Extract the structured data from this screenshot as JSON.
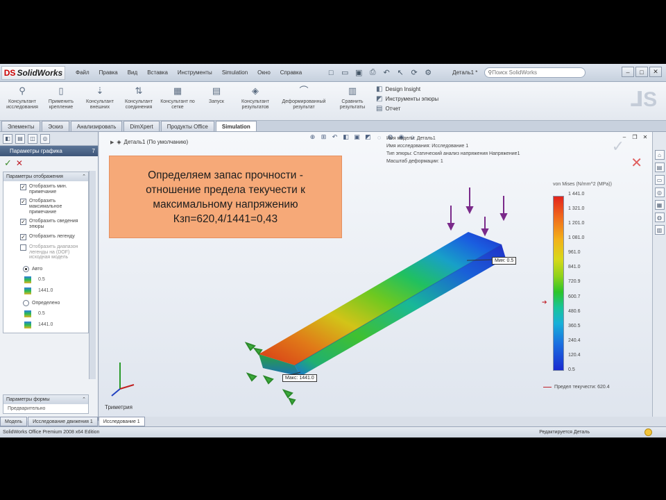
{
  "app": {
    "logo": "SolidWorks",
    "menu": [
      "Файл",
      "Правка",
      "Вид",
      "Вставка",
      "Инструменты",
      "Simulation",
      "Окно",
      "Справка"
    ],
    "document": "Деталь1 *",
    "search_placeholder": "Поиск SolidWorks"
  },
  "ribbon": {
    "buttons": [
      {
        "label": "Консультант исследования",
        "icon": "magnifier-icon"
      },
      {
        "label": "Применить крепление",
        "icon": "fixture-icon"
      },
      {
        "label": "Консультант внешних",
        "icon": "load-icon"
      },
      {
        "label": "Консультант соединения",
        "icon": "connection-icon"
      },
      {
        "label": "Консультант по сетке",
        "icon": "mesh-icon"
      },
      {
        "label": "Запуск",
        "icon": "run-icon"
      },
      {
        "label": "Консультант результатов",
        "icon": "results-icon"
      },
      {
        "label": "Деформированный результат",
        "icon": "deform-icon"
      },
      {
        "label": "Сравнить результаты",
        "icon": "compare-icon"
      }
    ],
    "side": [
      "Design Insight",
      "Инструменты эпюры",
      "Отчет"
    ]
  },
  "tabs": [
    "Элементы",
    "Эскиз",
    "Анализировать",
    "DimXpert",
    "Продукты Office",
    "Simulation"
  ],
  "tabs_active": 5,
  "left_panel": {
    "header": "Параметры графика",
    "header_num": "7",
    "group_title": "Параметры отображения",
    "checks": [
      {
        "label": "Отобразить мин. примечание",
        "checked": true,
        "dim": false
      },
      {
        "label": "Отобразить максимальное примечание",
        "checked": true,
        "dim": false
      },
      {
        "label": "Отобразить сведения эпюры",
        "checked": true,
        "dim": false
      },
      {
        "label": "Отобразить легенду",
        "checked": true,
        "dim": false
      },
      {
        "label": "Отобразить диапазон легенды на (DOF) исходная модель",
        "checked": false,
        "dim": true
      }
    ],
    "radio_auto": "Авто",
    "radio_defined": "Определено",
    "values": [
      "0.5",
      "1441.0",
      "0.5",
      "1441.0"
    ],
    "group2_title": "Параметры формы",
    "group2_sub": "Предварительно"
  },
  "viewport": {
    "tree_label": "Деталь1 (По умолчанию)",
    "note_lines": [
      "Определяем запас прочности -",
      "отношение предела текучести к",
      "максимальному напряжению",
      "Кзп=620,4/1441=0,43"
    ],
    "info_lines": [
      "Имя модели: Деталь1",
      "Имя исследования: Исследование 1",
      "Тип эпюры: Статический анализ напряжения Напряжение1",
      "Масштаб деформации: 1"
    ],
    "legend_title": "von Mises (N/mm^2 (MPa))",
    "legend_ticks": [
      "1 441.0",
      "1 321.0",
      "1 201.0",
      "1 081.0",
      "961.0",
      "841.0",
      "720.9",
      "600.7",
      "480.6",
      "360.5",
      "240.4",
      "120.4",
      "0.5"
    ],
    "yield_label": "Предел текучести: 620.4",
    "min_label": "Мин: 0.5",
    "max_label": "Макс: 1441.0",
    "triad_label": "Триметрия"
  },
  "bottom_tabs": [
    "Модель",
    "Исследование движения 1",
    "Исследование 1"
  ],
  "bottom_tab_active": 2,
  "status": {
    "left": "SolidWorks Office Premium 2008 x64 Edition",
    "right": "Редактируется Деталь"
  },
  "colors": {
    "note_bg": "#f6a978",
    "beam_hot": "#e2241c",
    "beam_cool": "#1a2ad0"
  }
}
